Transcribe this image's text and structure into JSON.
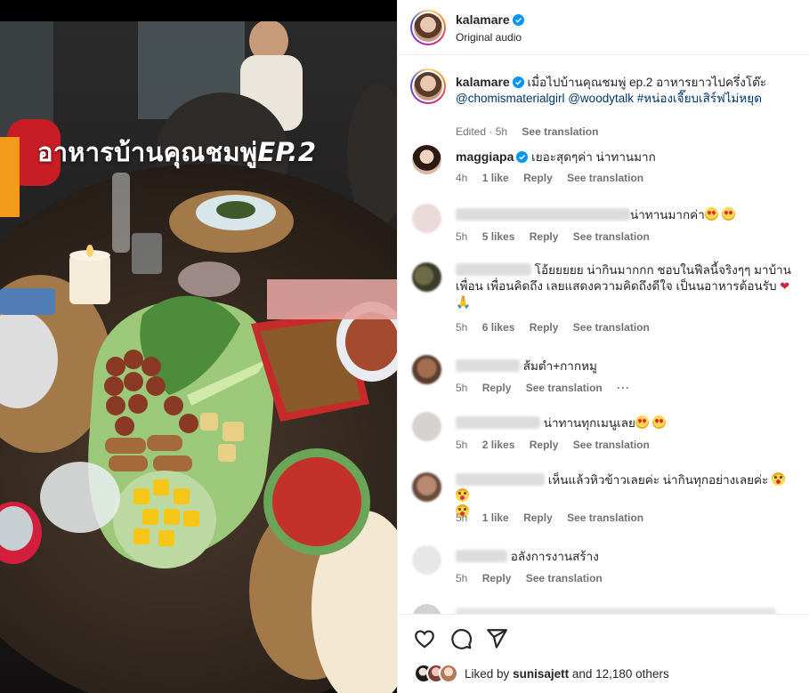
{
  "post": {
    "username": "kalamare",
    "audio": "Original audio",
    "overlay_text": "อาหารบ้านคุณชมพู่",
    "overlay_ep": "EP.2"
  },
  "caption": {
    "username": "kalamare",
    "text": "เมื่อไปบ้านคุณชมพู่ ep.2 อาหารยาวไปครึ่งโต๊ะ",
    "mentions": "@chomismaterialgirl @woodytalk #หน่องเจี๊ยบเสิร์ฟไม่หยุด",
    "edited": "Edited · 5h",
    "see_translation": "See translation"
  },
  "comments": [
    {
      "username": "maggiapa",
      "verified": true,
      "text": "เยอะสุดๆค่า น่าทานมาก",
      "time": "4h",
      "likes": "1 like",
      "reply": "Reply",
      "see_translation": "See translation"
    },
    {
      "username": "",
      "text": "น่าทานมากค่า",
      "emoji": 2,
      "time": "5h",
      "likes": "5 likes",
      "reply": "Reply",
      "see_translation": "See translation"
    },
    {
      "username": "",
      "text": "โอ้ยยยยย น่ากินมากกก ชอบในฟีลนี้จริงๆๆ มาบ้านเพื่อน เพื่อนคิดถึง เลยแสดงความคิดถึงดีใจ เป็นนอาหารต้อนรับ",
      "tail": "🙏",
      "time": "5h",
      "likes": "6 likes",
      "reply": "Reply",
      "see_translation": "See translation"
    },
    {
      "username": "",
      "text": "ส้มตำ+กากหมู",
      "time": "5h",
      "likes": "",
      "reply": "Reply",
      "see_translation": "See translation",
      "more": "···"
    },
    {
      "username": "",
      "text": "น่าทานทุกเมนูเลย",
      "emoji": 2,
      "time": "5h",
      "likes": "2 likes",
      "reply": "Reply",
      "see_translation": "See translation"
    },
    {
      "username": "",
      "text": "เห็นแล้วหิวข้าวเลยค่ะ น่ากินทุกอย่างเลยค่ะ",
      "time": "5h",
      "likes": "1 like",
      "reply": "Reply",
      "see_translation": "See translation"
    },
    {
      "username": "",
      "text": "อลังการงานสร้าง",
      "time": "5h",
      "likes": "",
      "reply": "Reply",
      "see_translation": "See translation"
    }
  ],
  "liked_by": {
    "prefix": "Liked by",
    "user": "sunisajett",
    "rest": "and 12,180 others"
  },
  "colors": {
    "link": "#00376b",
    "verified": "#0095f6",
    "muted": "#737373"
  }
}
